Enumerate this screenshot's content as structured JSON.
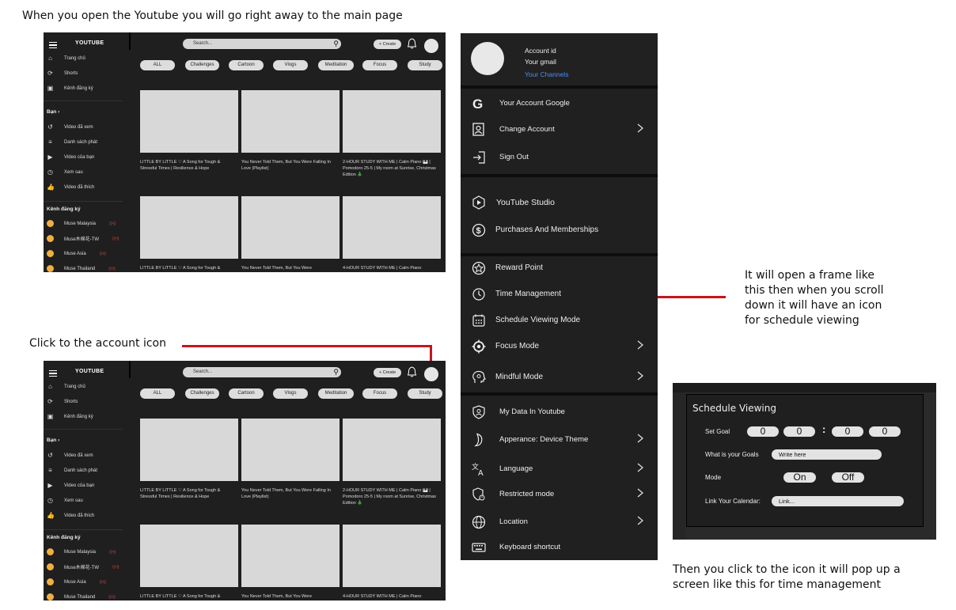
{
  "notes": {
    "top": "When you open the Youtube you will go right away to the main page",
    "click": "Click to the account icon",
    "frame": "It will open a frame like this then when you scroll down it will have an icon for schedule viewing",
    "popup": "Then you click to the icon it will pop up a screen like this for time management"
  },
  "youtube": {
    "brand": "YOUTUBE",
    "search_placeholder": "Search...",
    "create_label": "+ Create",
    "sidebar_main": [
      "Trang chủ",
      "Shorts",
      "Kênh đăng ký"
    ],
    "sidebar_you_heading": "Bạn",
    "sidebar_you": [
      "Video đã xem",
      "Danh sách phát",
      "Video của bạn",
      "Xem sau",
      "Video đã thích"
    ],
    "sidebar_subs_heading": "Kênh đăng ký",
    "channels": [
      "Muse Malaysia",
      "Muse木棉花-TW",
      "Muse Asia",
      "Muse Thailand"
    ],
    "chips": [
      "ALL",
      "Challenges",
      "Cartoon",
      "Vlogs",
      "Meditation",
      "Focus",
      "Study"
    ],
    "captions": [
      "LITTLE BY LITTLE ♡ A Song for Tough & Stressful Times | Resilience & Hope",
      "You Never Told Them, But You Were Falling In Love (Playlist)",
      "2-HOUR STUDY WITH ME | Calm Piano 🎹 | Pomodoro 25-5 | My room at Sunrise, Christmas Edition 🎄"
    ],
    "captions_row2": [
      "LITTLE BY LITTLE ♡ A Song for Tough &",
      "You Never Told Them, But You Were",
      "4-HOUR STUDY WITH ME | Calm Piano"
    ]
  },
  "account_menu": {
    "account_id": "Account id",
    "gmail": "Your gmail",
    "channels_link": "Your Channels",
    "group1": [
      "Your Account Google",
      "Change Account",
      "Sign Out"
    ],
    "group2": [
      "YouTube Studio",
      "Purchases And Memberships"
    ],
    "group3": [
      "Reward Point",
      "Time Management",
      "Schedule Viewing Mode",
      "Focus Mode",
      "Mindful Mode"
    ],
    "group4": [
      "My Data In Youtube",
      "Apperance: Device Theme",
      "Language",
      "Restricted mode",
      "Location",
      "Keyboard shortcut"
    ]
  },
  "schedule": {
    "title": "Schedule Viewing",
    "set_goal_label": "Set Goal",
    "goal_digits": [
      "0",
      "0",
      "0",
      "0"
    ],
    "goal_separator": ":",
    "what_goal_label": "What is your Goals",
    "what_goal_value": "Write here",
    "mode_label": "Mode",
    "mode_on": "On",
    "mode_off": "Off",
    "calendar_label": "Link Your Calendar:",
    "calendar_value": "Link..."
  },
  "colors": {
    "accent_red": "#c8141c",
    "link_blue": "#4a8ef0",
    "panel_dark": "#1f1f1f"
  }
}
